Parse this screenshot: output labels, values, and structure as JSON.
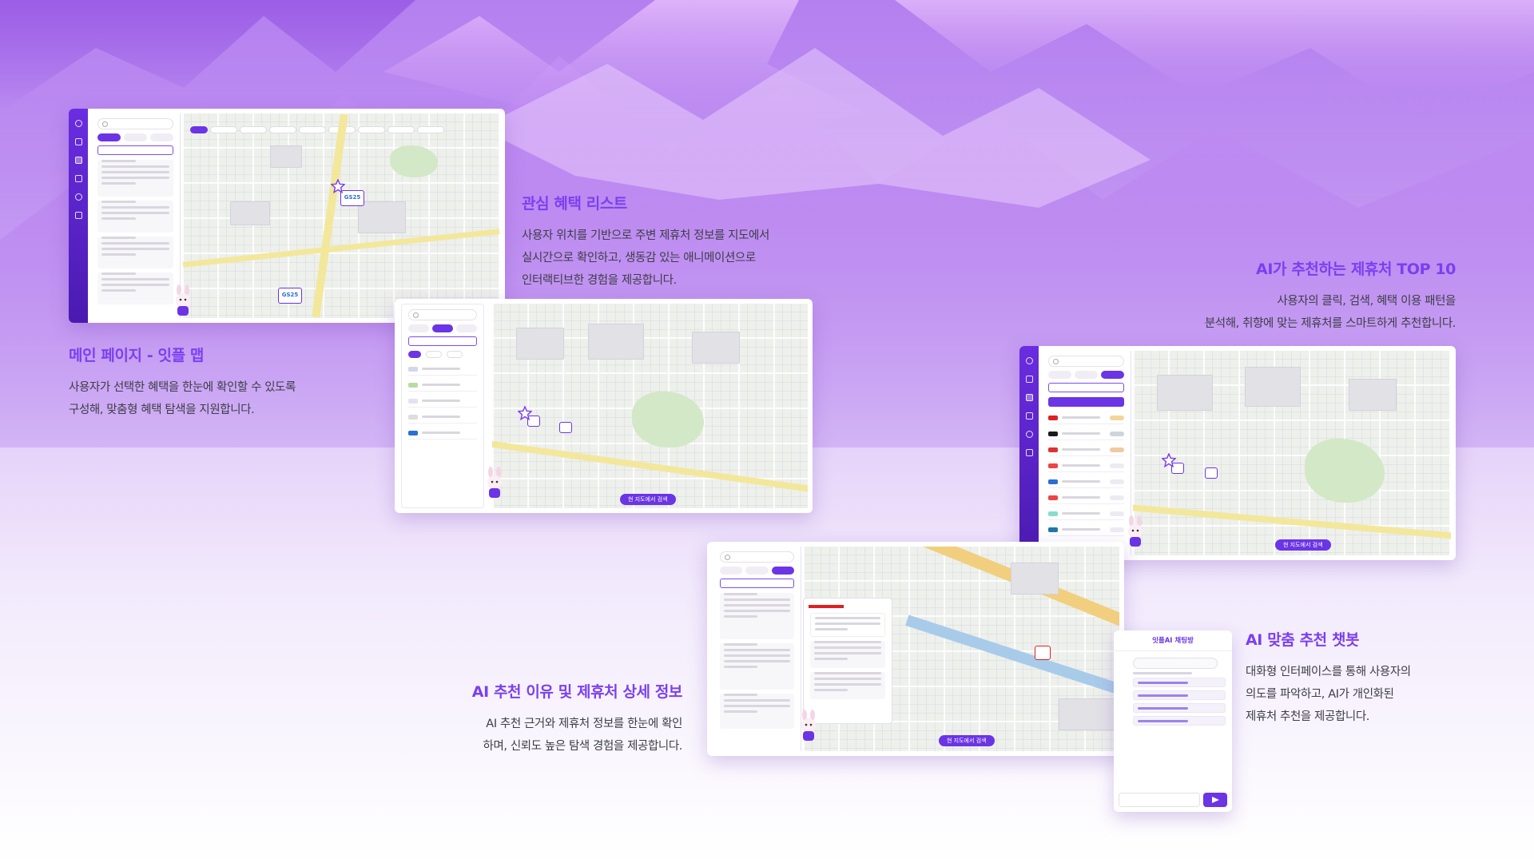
{
  "colors": {
    "accent": "#7b3ff2",
    "brand": "#6b34e5",
    "text": "#3d3d48"
  },
  "features": {
    "main_page": {
      "title": "메인 페이지 - 잇플 맵",
      "desc_line1": "사용자가 선택한 혜택을 한눈에 확인할 수 있도록",
      "desc_line2": "구성해, 맞춤형 혜택 탐색을 지원합니다."
    },
    "interest_list": {
      "title": "관심 혜택 리스트",
      "desc_line1": "사용자 위치를 기반으로 주변 제휴처 정보를 지도에서",
      "desc_line2": "실시간으로 확인하고, 생동감 있는 애니메이션으로",
      "desc_line3": "인터랙티브한 경험을 제공합니다."
    },
    "ai_top10": {
      "title": "AI가 추천하는 제휴처 TOP 10",
      "desc_line1": "사용자의 클릭, 검색, 혜택 이용 패턴을",
      "desc_line2": "분석해, 취향에 맞는 제휴처를 스마트하게 추천합니다."
    },
    "ai_reason": {
      "title": "AI 추천 이유 및 제휴처 상세 정보",
      "desc_line1": "AI 추천 근거와 제휴처 정보를 한눈에 확인",
      "desc_line2": "하며, 신뢰도 높은 탐색 경험을 제공합니다."
    },
    "ai_chatbot": {
      "title": "AI 맞춤 추천 챗봇",
      "desc_line1": "대화형 인터페이스를 통해 사용자의",
      "desc_line2": "의도를 파악하고, AI가 개인화된",
      "desc_line3": "제휴처 추천을 제공합니다."
    }
  },
  "screens": {
    "map_store_label_1": "GS25",
    "map_store_label_2": "GS25",
    "research_button": "현 지도에서 검색",
    "chat_title": "잇플AI 채팅방"
  },
  "icons": [
    "map-icon",
    "star-icon",
    "search-icon",
    "send-icon",
    "rabbit-mascot-icon"
  ]
}
